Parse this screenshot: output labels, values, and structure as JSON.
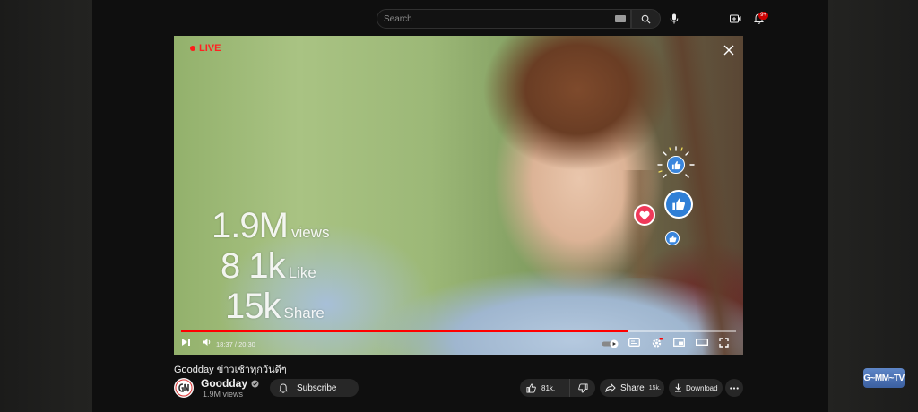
{
  "topbar": {
    "search_placeholder": "Search",
    "notification_count": "9+"
  },
  "video": {
    "live_label": "LIVE",
    "overlay": {
      "views_value": "1.9M",
      "views_label": "views",
      "likes_value": "8 1k",
      "likes_label": "Like",
      "shares_value": "15k",
      "shares_label": "Share"
    },
    "progress_fraction": 0.804,
    "current_time": "18:37",
    "duration": "20:30",
    "time_separator": "/"
  },
  "info": {
    "title": "Goodday ข่าวเช้าทุกวันดีๆ",
    "channel_name": "Goodday",
    "channel_subscribers": "1.9M views",
    "subscribe_label": "Subscribe",
    "like_count": "81k.",
    "share_label": "Share",
    "share_count": "15k.",
    "download_label": "Download"
  },
  "watermark": {
    "logo_text": "G~MM~TV"
  },
  "colors": {
    "live_red": "#ff2222",
    "progress_red": "#ff0000",
    "like_blue": "#2f7fd6",
    "heart_pink": "#f0395a"
  }
}
